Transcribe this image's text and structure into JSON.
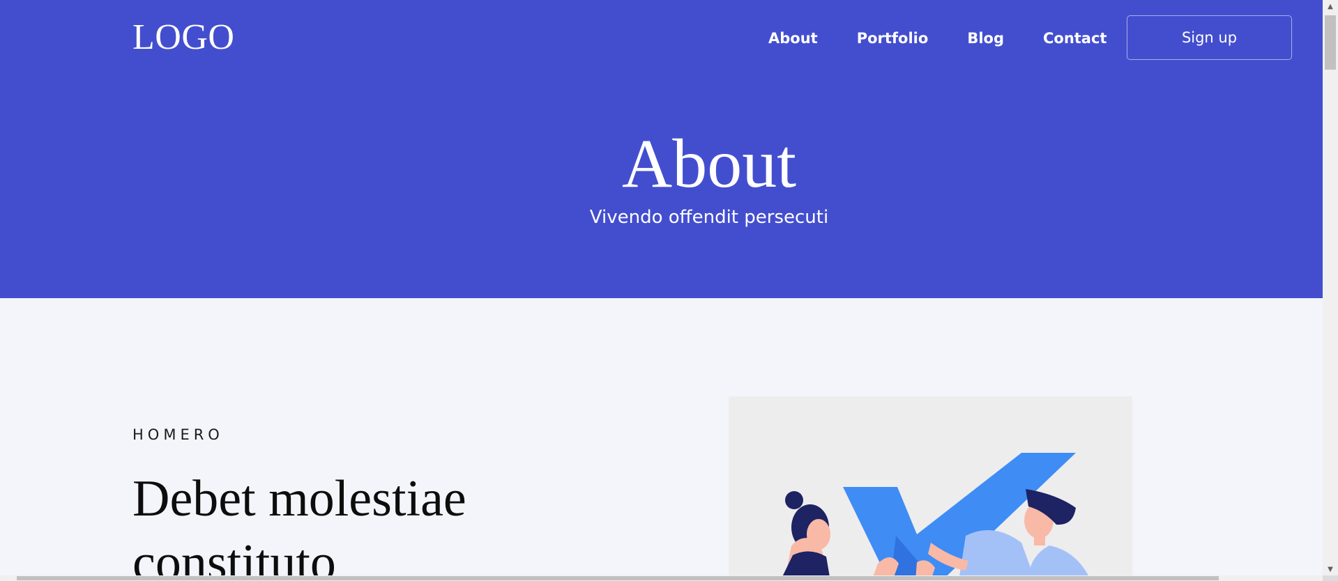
{
  "header": {
    "logo_text": "LOGO",
    "nav": [
      {
        "label": "About"
      },
      {
        "label": "Portfolio"
      },
      {
        "label": "Blog"
      },
      {
        "label": "Contact"
      }
    ],
    "signup_label": "Sign up"
  },
  "hero": {
    "title": "About",
    "subtitle": "Vivendo offendit persecuti"
  },
  "section": {
    "eyebrow": "HOMERO",
    "title": "Debet molestiae constituto"
  },
  "colors": {
    "brand": "#434ecf",
    "page_background": "#f4f5fa",
    "illustration_background": "#ededee"
  },
  "icons": [
    "scroll-up-arrow-icon",
    "scroll-down-arrow-icon"
  ]
}
